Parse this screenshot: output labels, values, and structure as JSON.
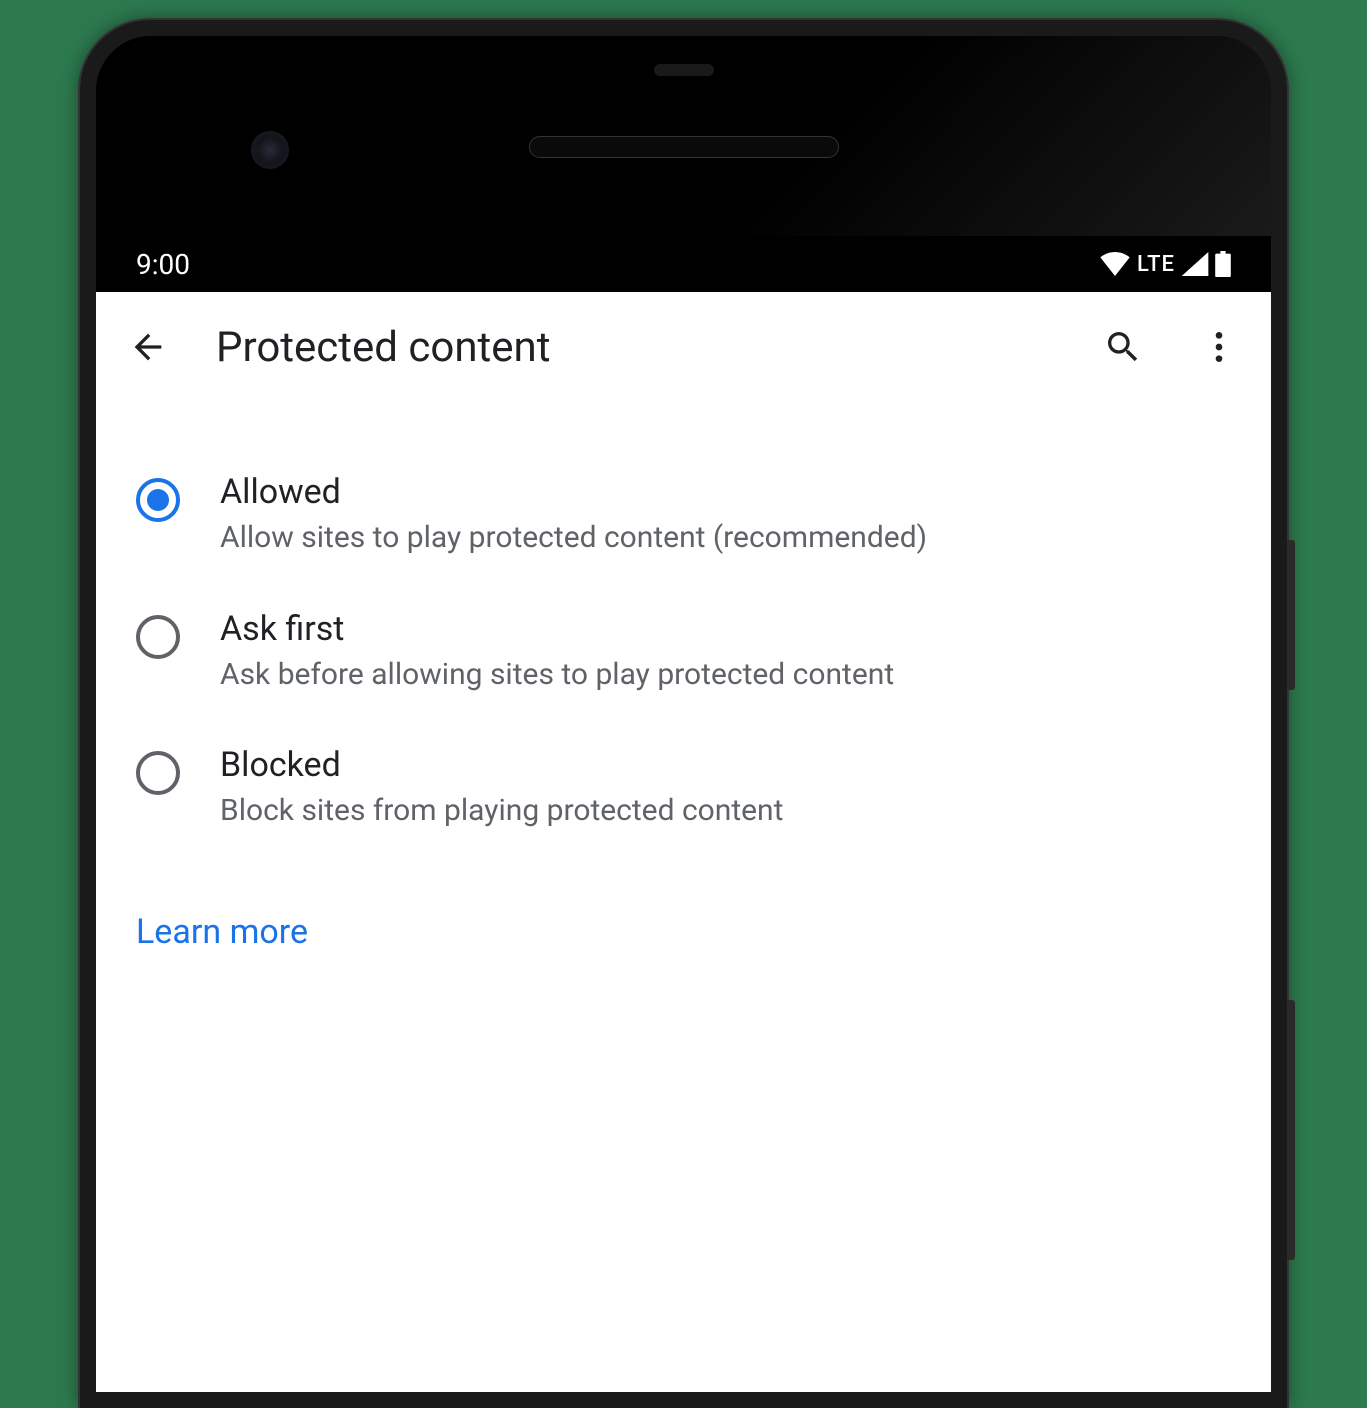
{
  "status_bar": {
    "time": "9:00",
    "network_label": "LTE"
  },
  "app_bar": {
    "title": "Protected content"
  },
  "options": [
    {
      "title": "Allowed",
      "description": "Allow sites to play protected content (recommended)",
      "selected": true
    },
    {
      "title": "Ask first",
      "description": "Ask before allowing sites to play protected content",
      "selected": false
    },
    {
      "title": "Blocked",
      "description": "Block sites from playing protected content",
      "selected": false
    }
  ],
  "footer": {
    "learn_more": "Learn more"
  },
  "colors": {
    "accent": "#1a73e8",
    "text_primary": "#202124",
    "text_secondary": "#5f6368"
  }
}
